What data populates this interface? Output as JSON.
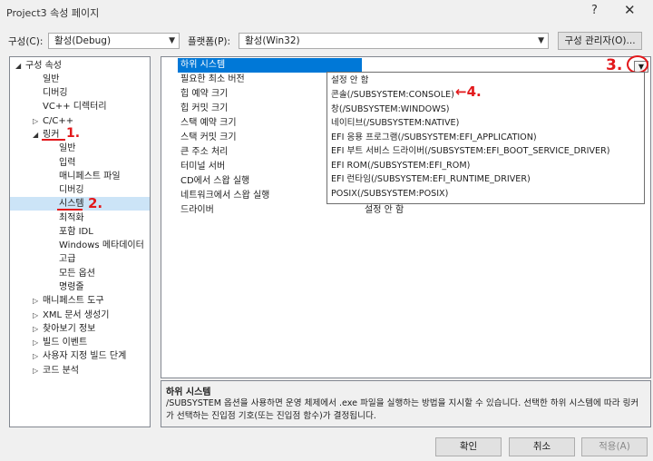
{
  "window": {
    "title": "Project3 속성 페이지",
    "help": "?",
    "close": "✕"
  },
  "config": {
    "label": "구성(C):",
    "value": "활성(Debug)",
    "platform_label": "플랫폼(P):",
    "platform_value": "활성(Win32)",
    "manager_button": "구성 관리자(O)..."
  },
  "tree": {
    "root": "구성 속성",
    "items": [
      "일반",
      "디버깅",
      "VC++ 디렉터리",
      "C/C++",
      "링커",
      "일반",
      "입력",
      "매니페스트 파일",
      "디버깅",
      "시스템",
      "최적화",
      "포함 IDL",
      "Windows 메타데이터",
      "고급",
      "모든 옵션",
      "명령줄",
      "매니페스트 도구",
      "XML 문서 생성기",
      "찾아보기 정보",
      "빌드 이벤트",
      "사용자 지정 빌드 단계",
      "코드 분석"
    ]
  },
  "properties": {
    "rows": [
      {
        "name": "하위 시스템",
        "value": ""
      },
      {
        "name": "필요한 최소 버전",
        "value": ""
      },
      {
        "name": "힙 예약 크기",
        "value": ""
      },
      {
        "name": "힙 커밋 크기",
        "value": ""
      },
      {
        "name": "스택 예약 크기",
        "value": ""
      },
      {
        "name": "스택 커밋 크기",
        "value": ""
      },
      {
        "name": "큰 주소 처리",
        "value": ""
      },
      {
        "name": "터미널 서버",
        "value": ""
      },
      {
        "name": "CD에서 스왑 실행",
        "value": ""
      },
      {
        "name": "네트워크에서 스왑 실행",
        "value": ""
      },
      {
        "name": "드라이버",
        "value": "설정 안 함"
      }
    ],
    "dropdown_icon": "chevron-down"
  },
  "dropdown": {
    "options": [
      "설정 안 함",
      "콘솔(/SUBSYSTEM:CONSOLE)",
      "창(/SUBSYSTEM:WINDOWS)",
      "네이티브(/SUBSYSTEM:NATIVE)",
      "EFI 응용 프로그램(/SUBSYSTEM:EFI_APPLICATION)",
      "EFI 부트 서비스 드라이버(/SUBSYSTEM:EFI_BOOT_SERVICE_DRIVER)",
      "EFI ROM(/SUBSYSTEM:EFI_ROM)",
      "EFI 런타임(/SUBSYSTEM:EFI_RUNTIME_DRIVER)",
      "POSIX(/SUBSYSTEM:POSIX)"
    ]
  },
  "description": {
    "title": "하위 시스템",
    "text": "/SUBSYSTEM 옵션을 사용하면 운영 체제에서 .exe 파일을 실행하는 방법을 지시할 수 있습니다. 선택한 하위 시스템에 따라 링커가 선택하는 진입점 기호(또는 진입점 함수)가 결정됩니다."
  },
  "buttons": {
    "ok": "확인",
    "cancel": "취소",
    "apply": "적용(A)"
  },
  "annotations": {
    "n1": "1.",
    "n2": "2.",
    "n3": "3.",
    "n4": "4."
  },
  "colors": {
    "selection": "#0078d7",
    "annotation": "#e2181b",
    "tree_selected": "#cce4f7"
  }
}
